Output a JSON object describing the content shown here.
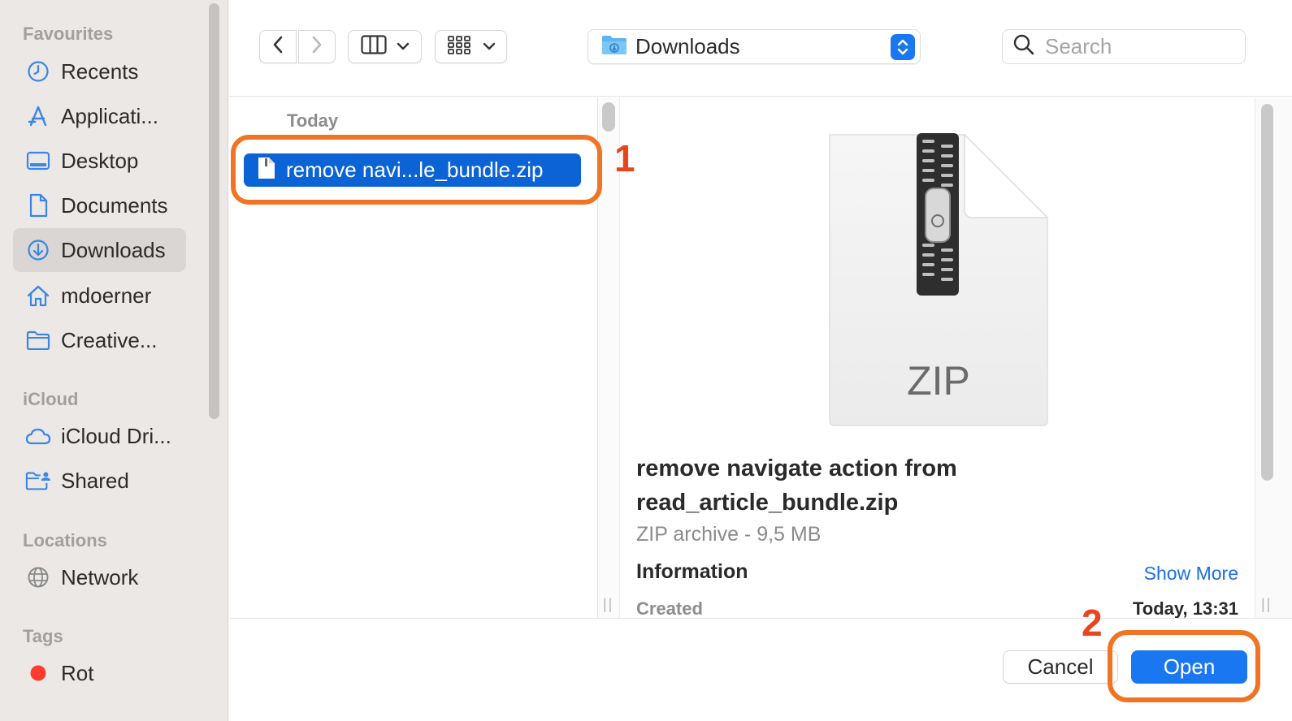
{
  "sidebar": {
    "sections": {
      "favourites": "Favourites",
      "icloud": "iCloud",
      "locations": "Locations",
      "tags": "Tags"
    },
    "items": [
      {
        "label": "Recents",
        "icon": "clock-icon"
      },
      {
        "label": "Applicati...",
        "icon": "applications-icon"
      },
      {
        "label": "Desktop",
        "icon": "desktop-icon"
      },
      {
        "label": "Documents",
        "icon": "document-icon"
      },
      {
        "label": "Downloads",
        "icon": "download-icon",
        "active": true
      },
      {
        "label": "mdoerner",
        "icon": "home-icon"
      },
      {
        "label": "Creative...",
        "icon": "folder-icon"
      },
      {
        "label": "iCloud Dri...",
        "icon": "cloud-icon"
      },
      {
        "label": "Shared",
        "icon": "shared-folder-icon"
      },
      {
        "label": "Network",
        "icon": "globe-icon"
      },
      {
        "label": "Rot",
        "icon": "red-tag-dot",
        "color": "#ff3b30"
      }
    ]
  },
  "toolbar": {
    "location": "Downloads",
    "search_placeholder": "Search"
  },
  "file_list": {
    "group_header": "Today",
    "selected_file": "remove navi...le_bundle.zip"
  },
  "preview": {
    "icon_text": "ZIP",
    "title": "remove navigate action from read_article_bundle.zip",
    "kind": "ZIP archive - 9,5 MB",
    "info_heading": "Information",
    "show_more": "Show More",
    "created_label": "Created",
    "created_value": "Today, 13:31"
  },
  "footer": {
    "cancel": "Cancel",
    "open": "Open"
  },
  "annotations": {
    "step1": "1",
    "step2": "2",
    "color": "#f07424"
  },
  "colors": {
    "accent": "#1a77f2",
    "selection": "#0b63d6",
    "sidebar_bg": "#ece8e5"
  }
}
